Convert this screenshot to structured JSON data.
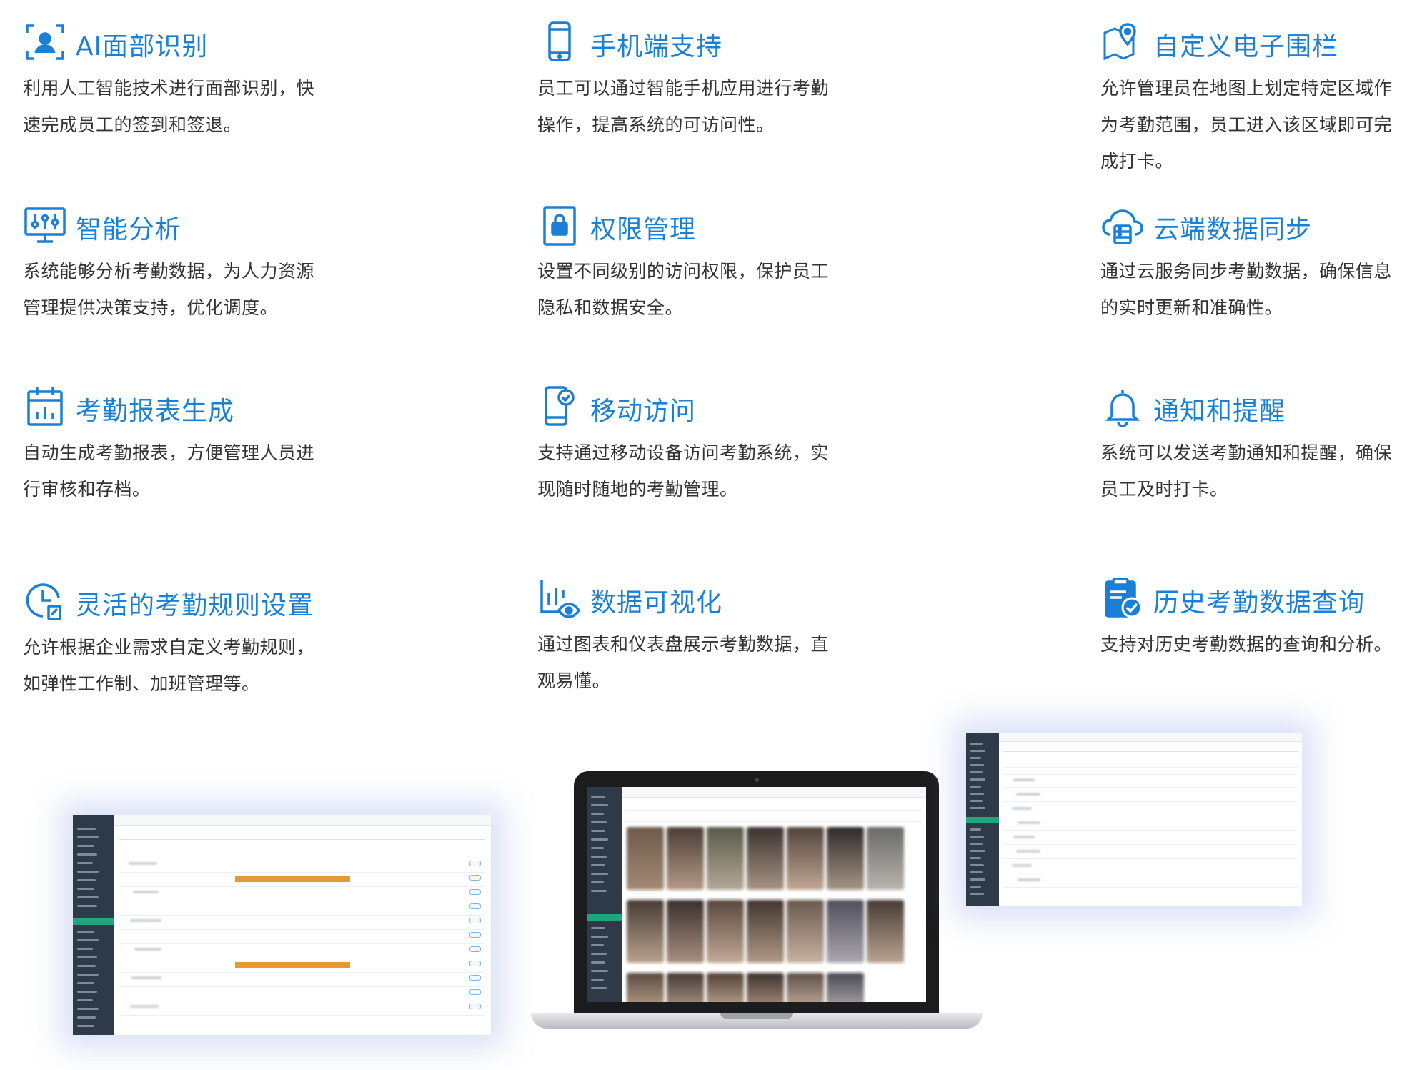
{
  "colors": {
    "accent": "#1a7fd6",
    "text": "#333333",
    "sidebar": "#2f3a49",
    "active": "#1fa67a",
    "highlight": "#e39a33"
  },
  "features": [
    {
      "title": "AI面部识别",
      "icon": "face-scan-icon",
      "lines": [
        "利用人工智能技术进行面部识别，快",
        "速完成员工的签到和签退。"
      ]
    },
    {
      "title": "手机端支持",
      "icon": "smartphone-icon",
      "lines": [
        "员工可以通过智能手机应用进行考勤",
        "操作，提高系统的可访问性。"
      ]
    },
    {
      "title": "自定义电子围栏",
      "icon": "map-pin-icon",
      "lines": [
        "允许管理员在地图上划定特定区域作",
        "为考勤范围，员工进入该区域即可完",
        "成打卡。"
      ]
    },
    {
      "title": "智能分析",
      "icon": "monitor-sliders-icon",
      "lines": [
        "系统能够分析考勤数据，为人力资源",
        "管理提供决策支持，优化调度。"
      ]
    },
    {
      "title": "权限管理",
      "icon": "lock-icon",
      "lines": [
        "设置不同级别的访问权限，保护员工",
        "隐私和数据安全。"
      ]
    },
    {
      "title": "云端数据同步",
      "icon": "cloud-sync-icon",
      "lines": [
        "通过云服务同步考勤数据，确保信息",
        "的实时更新和准确性。"
      ]
    },
    {
      "title": "考勤报表生成",
      "icon": "calendar-chart-icon",
      "lines": [
        "自动生成考勤报表，方便管理人员进",
        "行审核和存档。"
      ]
    },
    {
      "title": "移动访问",
      "icon": "mobile-check-icon",
      "lines": [
        "支持通过移动设备访问考勤系统，实",
        "现随时随地的考勤管理。"
      ]
    },
    {
      "title": "通知和提醒",
      "icon": "bell-icon",
      "lines": [
        "系统可以发送考勤通知和提醒，确保",
        "员工及时打卡。"
      ]
    },
    {
      "title": "灵活的考勤规则设置",
      "icon": "clock-edit-icon",
      "lines": [
        "允许根据企业需求自定义考勤规则，",
        "如弹性工作制、加班管理等。"
      ]
    },
    {
      "title": "数据可视化",
      "icon": "chart-eye-icon",
      "lines": [
        "通过图表和仪表盘展示考勤数据，直",
        "观易懂。"
      ]
    },
    {
      "title": "历史考勤数据查询",
      "icon": "clipboard-check-icon",
      "lines": [
        "支持对历史考勤数据的查询和分析。"
      ]
    }
  ]
}
